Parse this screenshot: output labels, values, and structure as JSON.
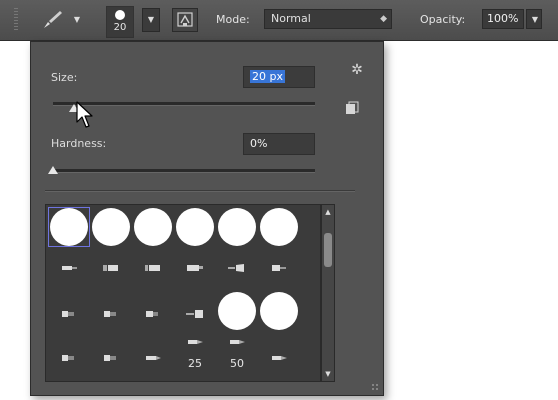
{
  "options_bar": {
    "brush_size": "20",
    "mode_label": "Mode:",
    "mode_value": "Normal",
    "opacity_label": "Opacity:",
    "opacity_value": "100%"
  },
  "panel": {
    "size_label": "Size:",
    "size_value": "20 px",
    "size_slider_fraction": 0.08,
    "hardness_label": "Hardness:",
    "hardness_value": "0%",
    "hardness_slider_fraction": 0.0,
    "brush_numbers": [
      "25",
      "50"
    ]
  },
  "icons": {
    "tool": "brush-icon",
    "panel_toggle": "brush-panel-icon",
    "settings": "gear-icon",
    "new_preset": "new-preset-icon",
    "cursor": "mouse-pointer-icon"
  },
  "colors": {
    "panel_bg": "#535353",
    "selection": "#3875d7",
    "selected_cell_border": "#6f74e0"
  }
}
